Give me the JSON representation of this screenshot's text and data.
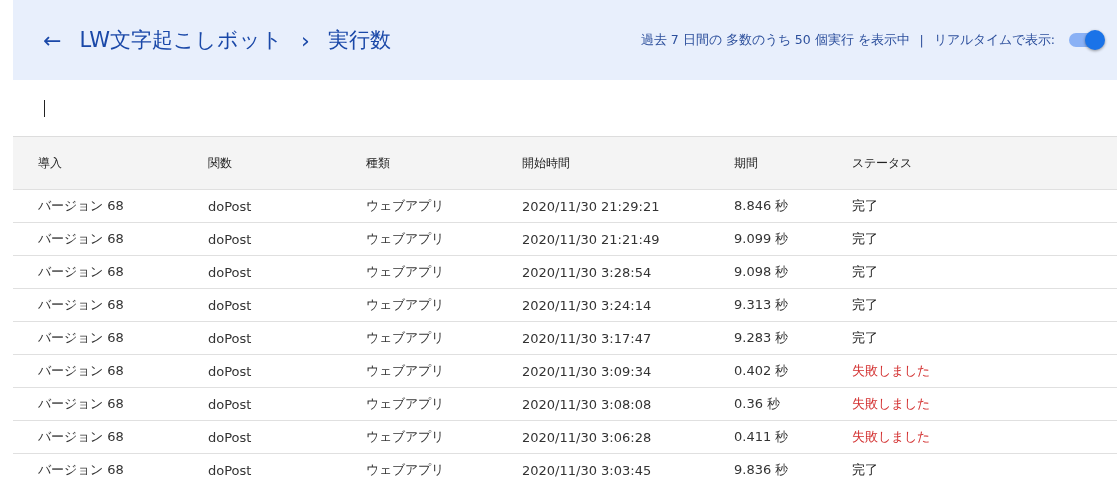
{
  "header": {
    "back_label": "←",
    "breadcrumb": [
      "LW文字起こしボット",
      "実行数"
    ],
    "separator": "›",
    "summary": "過去 7 日間の 多数のうち 50 個実行 を表示中",
    "divider": "|",
    "realtime_label": "リアルタイムで表示:",
    "realtime_on": true
  },
  "filter": {
    "focused": true
  },
  "table": {
    "columns": [
      "導入",
      "関数",
      "種類",
      "開始時間",
      "期間",
      "ステータス"
    ],
    "rows": [
      {
        "cells": [
          "バージョン 68",
          "doPost",
          "ウェブアプリ",
          "2020/11/30 21:29:21",
          "8.846 秒"
        ],
        "status": {
          "text": "完了",
          "kind": "success"
        }
      },
      {
        "cells": [
          "バージョン 68",
          "doPost",
          "ウェブアプリ",
          "2020/11/30 21:21:49",
          "9.099 秒"
        ],
        "status": {
          "text": "完了",
          "kind": "success"
        }
      },
      {
        "cells": [
          "バージョン 68",
          "doPost",
          "ウェブアプリ",
          "2020/11/30 3:28:54",
          "9.098 秒"
        ],
        "status": {
          "text": "完了",
          "kind": "success"
        }
      },
      {
        "cells": [
          "バージョン 68",
          "doPost",
          "ウェブアプリ",
          "2020/11/30 3:24:14",
          "9.313 秒"
        ],
        "status": {
          "text": "完了",
          "kind": "success"
        }
      },
      {
        "cells": [
          "バージョン 68",
          "doPost",
          "ウェブアプリ",
          "2020/11/30 3:17:47",
          "9.283 秒"
        ],
        "status": {
          "text": "完了",
          "kind": "success"
        }
      },
      {
        "cells": [
          "バージョン 68",
          "doPost",
          "ウェブアプリ",
          "2020/11/30 3:09:34",
          "0.402 秒"
        ],
        "status": {
          "text": "失敗しました",
          "kind": "failed"
        }
      },
      {
        "cells": [
          "バージョン 68",
          "doPost",
          "ウェブアプリ",
          "2020/11/30 3:08:08",
          "0.36 秒"
        ],
        "status": {
          "text": "失敗しました",
          "kind": "failed"
        }
      },
      {
        "cells": [
          "バージョン 68",
          "doPost",
          "ウェブアプリ",
          "2020/11/30 3:06:28",
          "0.411 秒"
        ],
        "status": {
          "text": "失敗しました",
          "kind": "failed"
        }
      },
      {
        "cells": [
          "バージョン 68",
          "doPost",
          "ウェブアプリ",
          "2020/11/30 3:03:45",
          "9.836 秒"
        ],
        "status": {
          "text": "完了",
          "kind": "success"
        }
      }
    ]
  }
}
